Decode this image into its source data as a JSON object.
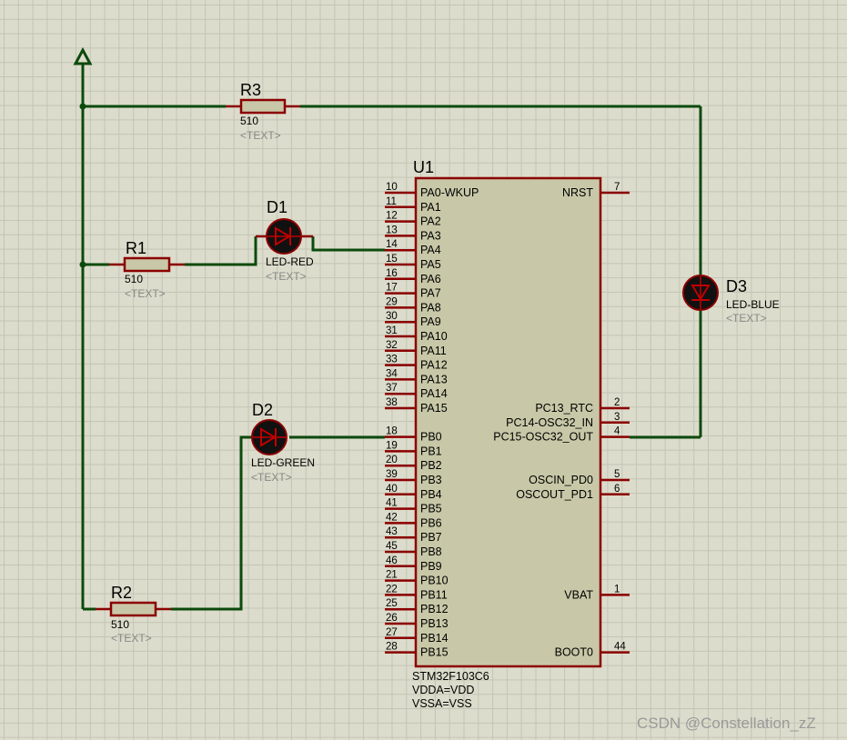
{
  "components": {
    "r1": {
      "ref": "R1",
      "value": "510",
      "text": "<TEXT>"
    },
    "r2": {
      "ref": "R2",
      "value": "510",
      "text": "<TEXT>"
    },
    "r3": {
      "ref": "R3",
      "value": "510",
      "text": "<TEXT>"
    },
    "d1": {
      "ref": "D1",
      "value": "LED-RED",
      "text": "<TEXT>"
    },
    "d2": {
      "ref": "D2",
      "value": "LED-GREEN",
      "text": "<TEXT>"
    },
    "d3": {
      "ref": "D3",
      "value": "LED-BLUE",
      "text": "<TEXT>"
    },
    "u1": {
      "ref": "U1",
      "part": "STM32F103C6",
      "note1": "VDDA=VDD",
      "note2": "VSSA=VSS",
      "left_pins": [
        {
          "num": "10",
          "name": "PA0-WKUP"
        },
        {
          "num": "11",
          "name": "PA1"
        },
        {
          "num": "12",
          "name": "PA2"
        },
        {
          "num": "13",
          "name": "PA3"
        },
        {
          "num": "14",
          "name": "PA4"
        },
        {
          "num": "15",
          "name": "PA5"
        },
        {
          "num": "16",
          "name": "PA6"
        },
        {
          "num": "17",
          "name": "PA7"
        },
        {
          "num": "29",
          "name": "PA8"
        },
        {
          "num": "30",
          "name": "PA9"
        },
        {
          "num": "31",
          "name": "PA10"
        },
        {
          "num": "32",
          "name": "PA11"
        },
        {
          "num": "33",
          "name": "PA12"
        },
        {
          "num": "34",
          "name": "PA13"
        },
        {
          "num": "37",
          "name": "PA14"
        },
        {
          "num": "38",
          "name": "PA15"
        },
        {
          "num": "",
          "name": ""
        },
        {
          "num": "18",
          "name": "PB0"
        },
        {
          "num": "19",
          "name": "PB1"
        },
        {
          "num": "20",
          "name": "PB2"
        },
        {
          "num": "39",
          "name": "PB3"
        },
        {
          "num": "40",
          "name": "PB4"
        },
        {
          "num": "41",
          "name": "PB5"
        },
        {
          "num": "42",
          "name": "PB6"
        },
        {
          "num": "43",
          "name": "PB7"
        },
        {
          "num": "45",
          "name": "PB8"
        },
        {
          "num": "46",
          "name": "PB9"
        },
        {
          "num": "21",
          "name": "PB10"
        },
        {
          "num": "22",
          "name": "PB11"
        },
        {
          "num": "25",
          "name": "PB12"
        },
        {
          "num": "26",
          "name": "PB13"
        },
        {
          "num": "27",
          "name": "PB14"
        },
        {
          "num": "28",
          "name": "PB15"
        }
      ],
      "right_pins": [
        {
          "num": "7",
          "name": "NRST",
          "row": 0
        },
        {
          "num": "2",
          "name": "PC13_RTC",
          "row": 15
        },
        {
          "num": "3",
          "name": "PC14-OSC32_IN",
          "row": 16
        },
        {
          "num": "4",
          "name": "PC15-OSC32_OUT",
          "row": 17
        },
        {
          "num": "5",
          "name": "OSCIN_PD0",
          "row": 20
        },
        {
          "num": "6",
          "name": "OSCOUT_PD1",
          "row": 21
        },
        {
          "num": "1",
          "name": "VBAT",
          "row": 28
        },
        {
          "num": "44",
          "name": "BOOT0",
          "row": 32
        }
      ]
    }
  },
  "watermark": "CSDN @Constellation_zZ"
}
